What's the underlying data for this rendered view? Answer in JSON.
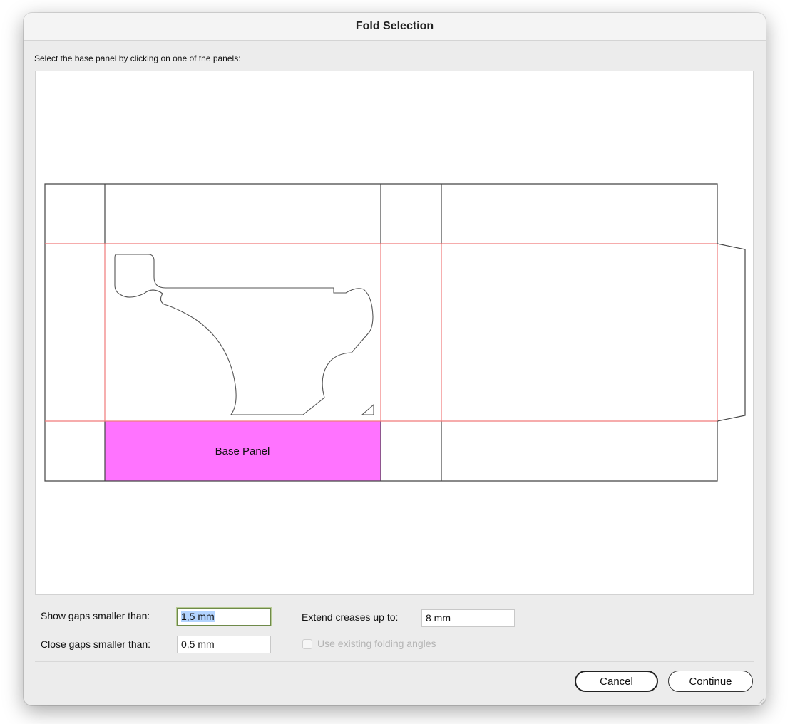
{
  "dialog": {
    "title": "Fold Selection",
    "instruction": "Select the base panel by clicking on one of the panels:"
  },
  "preview": {
    "base_panel_label": "Base Panel",
    "colors": {
      "cut_line": "#444444",
      "crease_line": "#f07a7a",
      "selected_panel_fill": "#ff73ff"
    }
  },
  "options": {
    "show_gaps_label": "Show gaps smaller than:",
    "show_gaps_value": "1,5 mm",
    "close_gaps_label": "Close gaps smaller than:",
    "close_gaps_value": "0,5 mm",
    "extend_creases_label": "Extend creases up to:",
    "extend_creases_value": "8 mm",
    "use_existing_angles_label": "Use existing folding angles",
    "use_existing_angles_checked": false,
    "use_existing_angles_enabled": false
  },
  "buttons": {
    "cancel": "Cancel",
    "continue": "Continue"
  }
}
